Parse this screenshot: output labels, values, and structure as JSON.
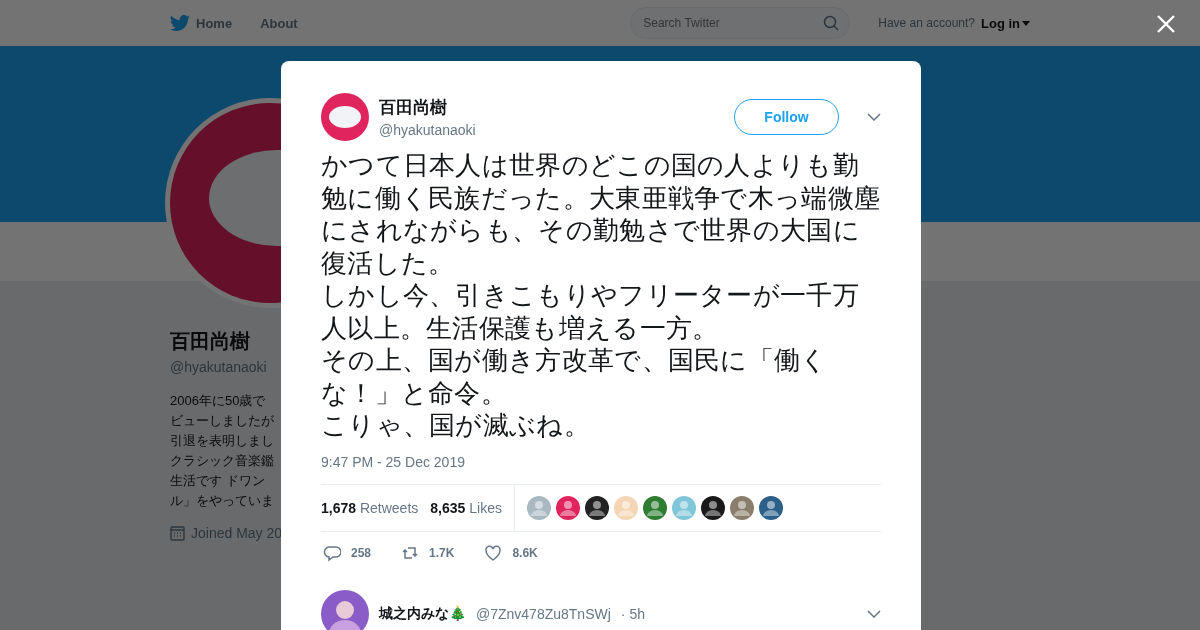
{
  "header": {
    "nav": [
      {
        "label": "Home",
        "kind": "home"
      },
      {
        "label": "About",
        "kind": "plain"
      }
    ],
    "search": {
      "placeholder": "Search Twitter"
    },
    "account_prompt": "Have an account?",
    "login": "Log in"
  },
  "profile": {
    "name": "百田尚樹",
    "handle": "@hyakutanaoki",
    "bio_lines": [
      "2006年に50歳で",
      "ビューしましたが",
      "引退を表明しまし",
      "クラシック音楽鑑",
      "生活です ドワン",
      "ル」をやっていま"
    ],
    "joined": "Joined May 20"
  },
  "tweet": {
    "name": "百田尚樹",
    "handle": "@hyakutanaoki",
    "follow": "Follow",
    "paragraphs": [
      "かつて日本人は世界のどこの国の人よりも勤勉に働く民族だった。大東亜戦争で木っ端微塵にされながらも、その勤勉さで世界の大国に復活した。",
      "しかし今、引きこもりやフリーターが一千万人以上。生活保護も増える一方。",
      "その上、国が働き方改革で、国民に「働くな！」と命令。",
      "こりゃ、国が滅ぶね。"
    ],
    "time": "9:47 PM - 25 Dec 2019",
    "stats": [
      {
        "count": "1,678",
        "label": "Retweets"
      },
      {
        "count": "8,635",
        "label": "Likes"
      }
    ],
    "actions": [
      {
        "kind": "reply",
        "count": "258"
      },
      {
        "kind": "retweet",
        "count": "1.7K"
      },
      {
        "kind": "like",
        "count": "8.6K"
      }
    ]
  },
  "reply": {
    "name": "城之内みな🎄",
    "handle": "@7Znv478Zu8TnSWj",
    "time": "· 5h"
  }
}
